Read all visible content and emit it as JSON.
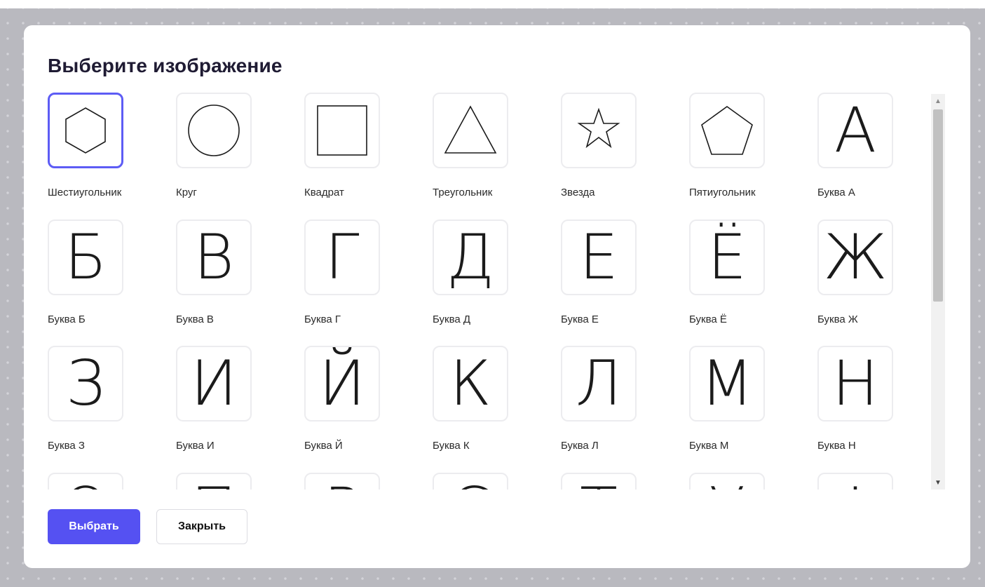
{
  "dialog": {
    "title": "Выберите изображение",
    "select_label": "Выбрать",
    "close_label": "Закрыть"
  },
  "colors": {
    "accent": "#5551f2",
    "selected_border": "#5d5cf5"
  },
  "items": [
    {
      "label": "Шестиугольник",
      "icon": "hexagon-icon",
      "selected": true
    },
    {
      "label": "Круг",
      "icon": "circle-icon"
    },
    {
      "label": "Квадрат",
      "icon": "square-icon"
    },
    {
      "label": "Треугольник",
      "icon": "triangle-icon"
    },
    {
      "label": "Звезда",
      "icon": "star-icon"
    },
    {
      "label": "Пятиугольник",
      "icon": "pentagon-icon"
    },
    {
      "label": "Буква А",
      "glyph": "А"
    },
    {
      "label": "Буква Б",
      "glyph": "Б"
    },
    {
      "label": "Буква В",
      "glyph": "В"
    },
    {
      "label": "Буква Г",
      "glyph": "Г"
    },
    {
      "label": "Буква Д",
      "glyph": "Д"
    },
    {
      "label": "Буква Е",
      "glyph": "Е"
    },
    {
      "label": "Буква Ё",
      "glyph": "Ё"
    },
    {
      "label": "Буква Ж",
      "glyph": "Ж"
    },
    {
      "label": "Буква З",
      "glyph": "З"
    },
    {
      "label": "Буква И",
      "glyph": "И"
    },
    {
      "label": "Буква Й",
      "glyph": "Й"
    },
    {
      "label": "Буква К",
      "glyph": "К"
    },
    {
      "label": "Буква Л",
      "glyph": "Л"
    },
    {
      "label": "Буква М",
      "glyph": "М"
    },
    {
      "label": "Буква Н",
      "glyph": "Н"
    },
    {
      "glyph": "О"
    },
    {
      "glyph": "П"
    },
    {
      "glyph": "Р"
    },
    {
      "glyph": "С"
    },
    {
      "glyph": "Т"
    },
    {
      "glyph": "У"
    },
    {
      "glyph": "Ф"
    }
  ]
}
